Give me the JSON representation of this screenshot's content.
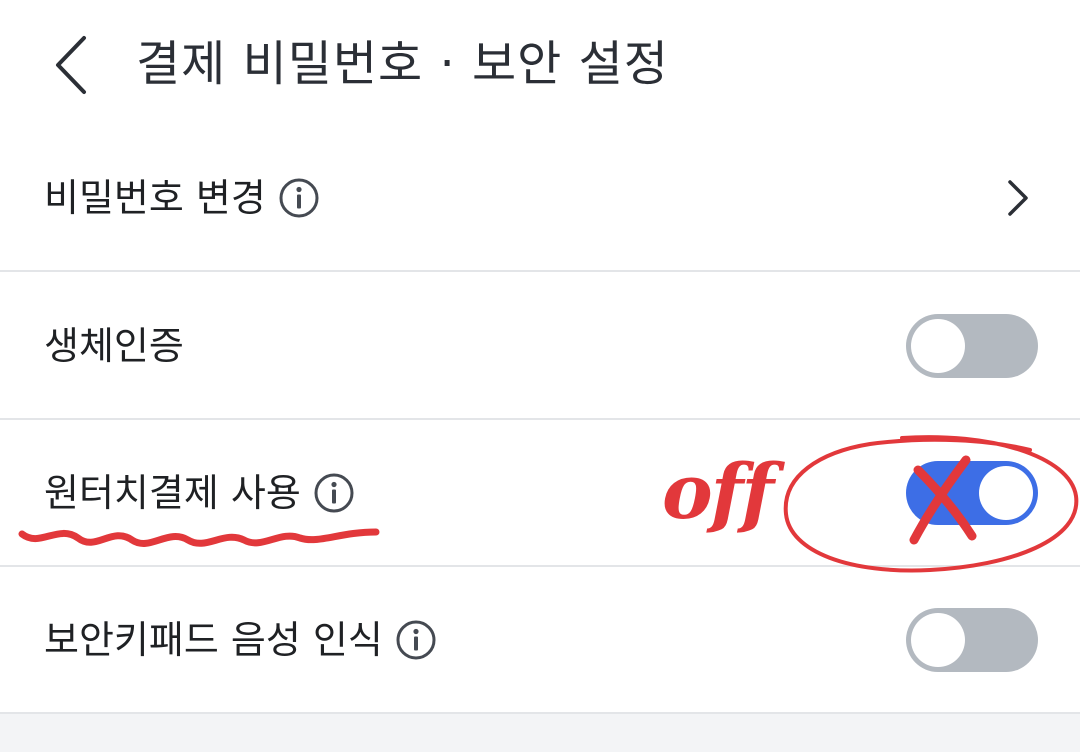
{
  "header": {
    "title": "결제 비밀번호 · 보안 설정",
    "back_icon": "chevron-left-icon"
  },
  "settings": {
    "password_change": {
      "label": "비밀번호 변경",
      "has_info": true,
      "trailing_icon": "chevron-right-icon"
    },
    "biometric": {
      "label": "생체인증",
      "toggle_on": false
    },
    "one_touch_payment": {
      "label": "원터치결제 사용",
      "has_info": true,
      "toggle_on": true
    },
    "keypad_voice": {
      "label": "보안키패드 음성 인식",
      "has_info": true,
      "toggle_on": false
    }
  },
  "annotations": {
    "handwritten_note": "off",
    "ink_color": "#e2383b"
  },
  "colors": {
    "toggle_on": "#3d6ee6",
    "toggle_off": "#b3b9c0",
    "divider": "#e3e5e8"
  }
}
